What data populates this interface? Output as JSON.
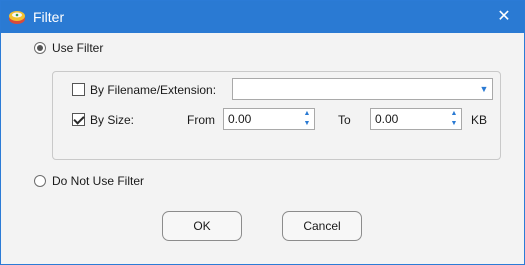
{
  "window": {
    "title": "Filter",
    "close_glyph": "✕",
    "accent_color": "#2a7ad3",
    "app_icon": "red-drive-icon"
  },
  "options": {
    "use_filter": {
      "label": "Use Filter",
      "selected": true
    },
    "do_not_use_filter": {
      "label": "Do Not Use Filter",
      "selected": false
    }
  },
  "filter": {
    "by_filename": {
      "label": "By Filename/Extension:",
      "checked": false,
      "value": ""
    },
    "by_size": {
      "label": "By Size:",
      "checked": true,
      "from_label": "From",
      "from_value": "0.00",
      "to_label": "To",
      "to_value": "0.00",
      "unit": "KB"
    }
  },
  "buttons": {
    "ok": "OK",
    "cancel": "Cancel"
  }
}
